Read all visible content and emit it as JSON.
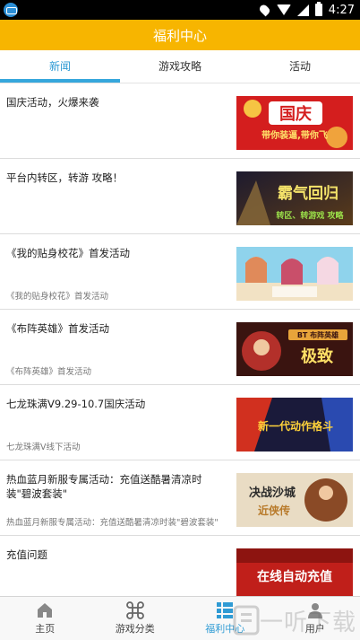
{
  "status_bar": {
    "time": "4:27"
  },
  "header": {
    "title": "福利中心"
  },
  "tabs": [
    {
      "label": "新闻",
      "active": true
    },
    {
      "label": "游戏攻略",
      "active": false
    },
    {
      "label": "活动",
      "active": false
    }
  ],
  "items": [
    {
      "title": "国庆活动，火爆来袭",
      "subtitle": "",
      "thumb_text": "国庆",
      "thumb_text2": "带你装逼,带你飞"
    },
    {
      "title": "平台内转区，转游 攻略！",
      "subtitle": "",
      "thumb_text": "霸气回归",
      "thumb_text2": "转区、转游戏 攻略"
    },
    {
      "title": "《我的贴身校花》首发活动",
      "subtitle": "《我的贴身校花》首发活动",
      "thumb_text": "",
      "thumb_text2": ""
    },
    {
      "title": "《布阵英雄》首发活动",
      "subtitle": "《布阵英雄》首发活动",
      "thumb_text": "极致",
      "thumb_text2": "BT 布阵英雄"
    },
    {
      "title": "七龙珠满V9.29-10.7国庆活动",
      "subtitle": "七龙珠满V线下活动",
      "thumb_text": "新一代动作格斗",
      "thumb_text2": ""
    },
    {
      "title": "热血蓝月新服专属活动：充值送酷暑清凉时装\"碧波套装\"",
      "subtitle": "热血蓝月新服专属活动：充值送酷暑清凉时装\"碧波套装\"",
      "thumb_text": "决战沙城",
      "thumb_text2": "近侠传"
    },
    {
      "title": "充值问题",
      "subtitle": "",
      "thumb_text": "在线自动充值",
      "thumb_text2": ""
    }
  ],
  "bottom_nav": [
    {
      "label": "主页",
      "icon": "home-icon",
      "active": false
    },
    {
      "label": "游戏分类",
      "icon": "command-icon",
      "active": false
    },
    {
      "label": "福利中心",
      "icon": "gift-list-icon",
      "active": true
    },
    {
      "label": "用户",
      "icon": "user-icon",
      "active": false
    }
  ],
  "watermark": {
    "text": "一听下载"
  },
  "colors": {
    "header": "#f7b500",
    "accent": "#2f9bd4",
    "tab_indicator": "#36a7dc"
  }
}
